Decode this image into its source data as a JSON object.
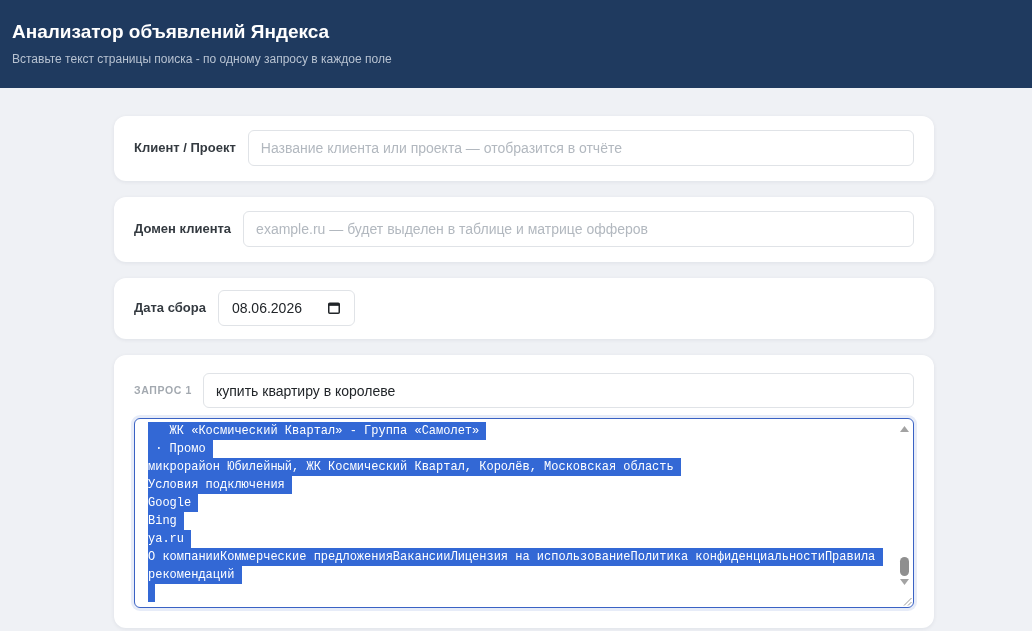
{
  "header": {
    "title": "Анализатор объявлений Яндекса",
    "subtitle": "Вставьте текст страницы поиска - по одному запросу в каждое поле"
  },
  "fields": [
    {
      "kind": "text",
      "label": "Клиент / Проект",
      "placeholder": "Название клиента или проекта — отобразится в отчёте"
    },
    {
      "kind": "text",
      "label": "Домен клиента",
      "placeholder": "example.ru — будет выделен в таблице и матрице офферов"
    },
    {
      "kind": "date",
      "label": "Дата сбора",
      "value": "08.06.2026"
    }
  ],
  "queries": [
    {
      "label": "ЗАПРОС 1",
      "value": "купить квартиру в королеве",
      "page_text": {
        "focused": true,
        "all_selected": true,
        "lines": [
          "   ЖК «Космический Квартал» - Группа «Самолет»",
          " · Промо",
          "микрорайон Юбилейный, ЖК Космический Квартал, Королёв, Московская область",
          "Условия подключения",
          "Google",
          "Bing",
          "ya.ru",
          "О компанииКоммерческие предложенияВакансииЛицензия на использованиеПолитика конфиденциальностиПравила",
          "рекомендаций"
        ]
      }
    }
  ]
}
